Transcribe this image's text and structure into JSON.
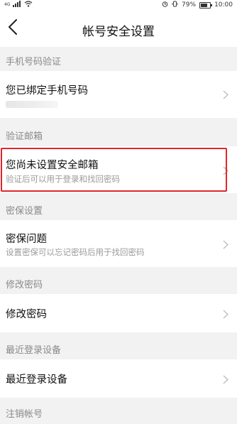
{
  "status_bar": {
    "carrier": "4G",
    "battery": "79%",
    "time": "10:00"
  },
  "header": {
    "title": "帐号安全设置"
  },
  "sections": [
    {
      "header": "手机号码验证",
      "item_title": "您已绑定手机号码",
      "item_subtitle": ""
    },
    {
      "header": "验证邮箱",
      "item_title": "您尚未设置安全邮箱",
      "item_subtitle": "验证后可以用于登录和找回密码"
    },
    {
      "header": "密保设置",
      "item_title": "密保问题",
      "item_subtitle": "设置密保可以忘记密码后用于找回密码"
    },
    {
      "header": "修改密码",
      "item_title": "修改密码",
      "item_subtitle": ""
    },
    {
      "header": "最近登录设备",
      "item_title": "最近登录设备",
      "item_subtitle": ""
    },
    {
      "header": "注销帐号",
      "item_title": "",
      "item_subtitle": ""
    }
  ],
  "colors": {
    "highlight": "#e0262b",
    "background": "#f2f2f2"
  },
  "icons": [
    "back-arrow-icon",
    "chevron-right-icon",
    "signal-icon",
    "wifi-icon",
    "alarm-icon",
    "vibrate-icon",
    "battery-icon"
  ]
}
